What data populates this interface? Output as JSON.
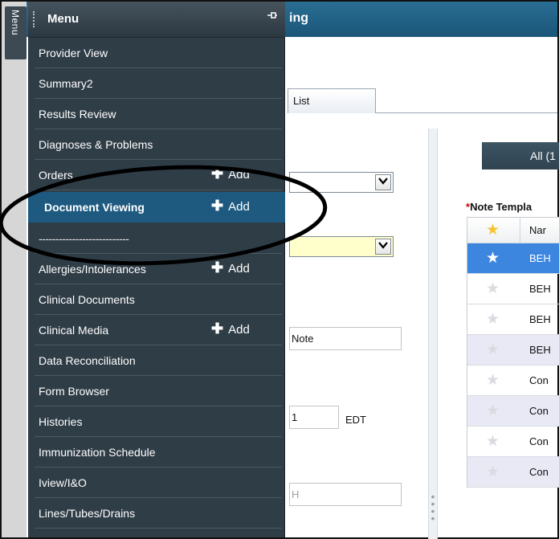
{
  "app": {
    "title": "ing",
    "tab_label": "List",
    "select_arrow": "▾",
    "note_input_value": "Note",
    "time_input_value": "1",
    "timezone": "EDT",
    "h_input_value": "H",
    "all_button_label": "All (1",
    "note_templates": {
      "required_mark": "*",
      "label": "Note Templa",
      "header_name": "Nar",
      "rows": [
        {
          "name": "BEH",
          "selected": true
        },
        {
          "name": "BEH"
        },
        {
          "name": "BEH"
        },
        {
          "name": "BEH"
        },
        {
          "name": "Con"
        },
        {
          "name": "Con"
        },
        {
          "name": "Con"
        },
        {
          "name": "Con"
        }
      ]
    }
  },
  "menu": {
    "rail_label": "Menu",
    "title": "Menu",
    "pin_icon": "pin-icon",
    "add_label": "Add",
    "items": [
      {
        "label": "Provider View"
      },
      {
        "label": "Summary2"
      },
      {
        "label": "Results Review"
      },
      {
        "label": "Diagnoses & Problems"
      },
      {
        "label": "Orders",
        "add": true
      },
      {
        "label": "Document Viewing",
        "add": true,
        "active": true
      },
      {
        "label": "---------------------------"
      },
      {
        "label": "Allergies/Intolerances",
        "add": true
      },
      {
        "label": "Clinical Documents"
      },
      {
        "label": "Clinical Media",
        "add": true
      },
      {
        "label": "Data Reconciliation"
      },
      {
        "label": "Form Browser"
      },
      {
        "label": "Histories"
      },
      {
        "label": "Immunization Schedule"
      },
      {
        "label": "Iview/I&O"
      },
      {
        "label": "Lines/Tubes/Drains"
      }
    ]
  },
  "colors": {
    "menu_bg": "#2f3d47",
    "menu_active": "#1e5a80",
    "titlebar": "#1a5579",
    "selected_row": "#3c86e0"
  }
}
